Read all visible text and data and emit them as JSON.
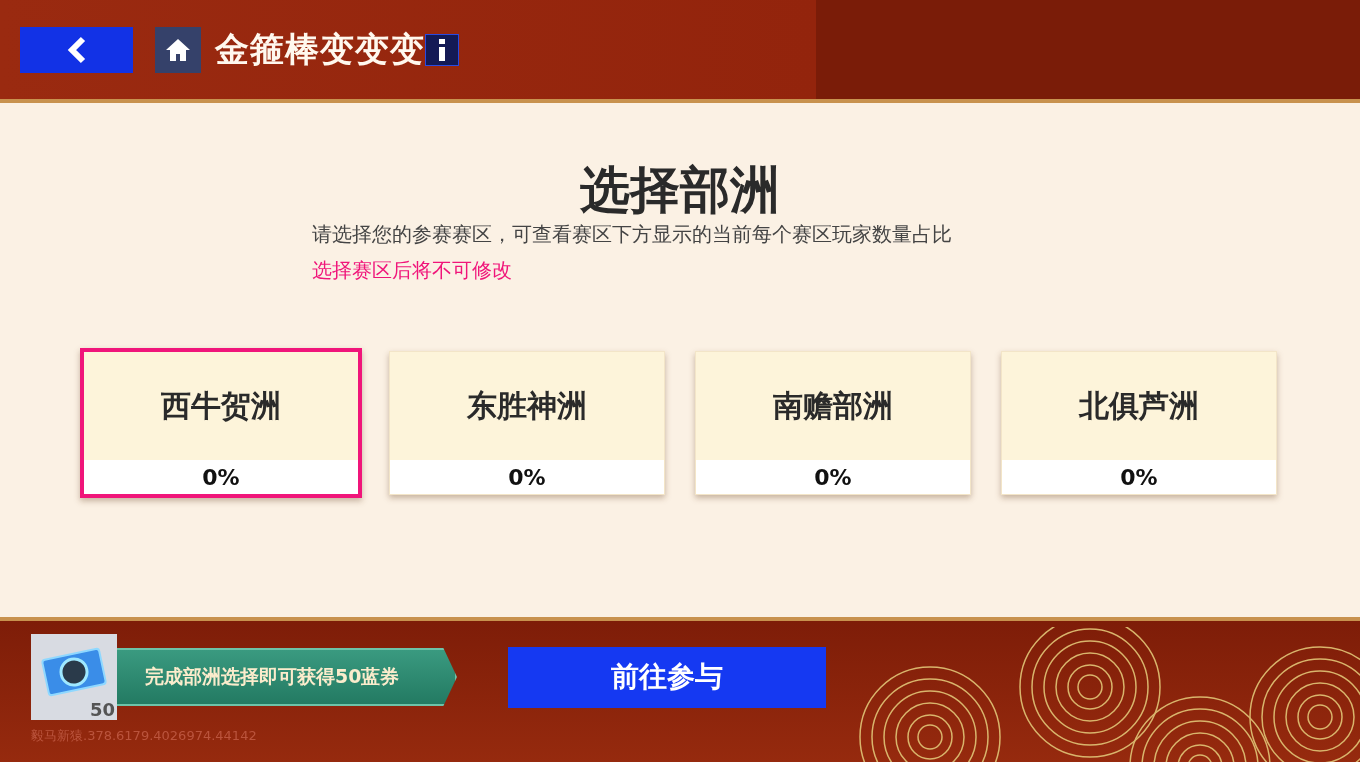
{
  "header": {
    "title": "金箍棒变变变"
  },
  "panel": {
    "heading": "选择部洲",
    "description": "请选择您的参赛赛区，可查看赛区下方显示的当前每个赛区玩家数量占比",
    "warning": "选择赛区后将不可修改"
  },
  "regions": [
    {
      "name": "西牛贺洲",
      "share": "0%",
      "selected": true
    },
    {
      "name": "东胜神洲",
      "share": "0%",
      "selected": false
    },
    {
      "name": "南赡部洲",
      "share": "0%",
      "selected": false
    },
    {
      "name": "北俱芦洲",
      "share": "0%",
      "selected": false
    }
  ],
  "footer": {
    "reward_count": "50",
    "reward_text": "完成部洲选择即可获得50蓝券",
    "join_button": "前往参与",
    "watermark": "毅马新猿.378.6179.4026974.44142"
  }
}
